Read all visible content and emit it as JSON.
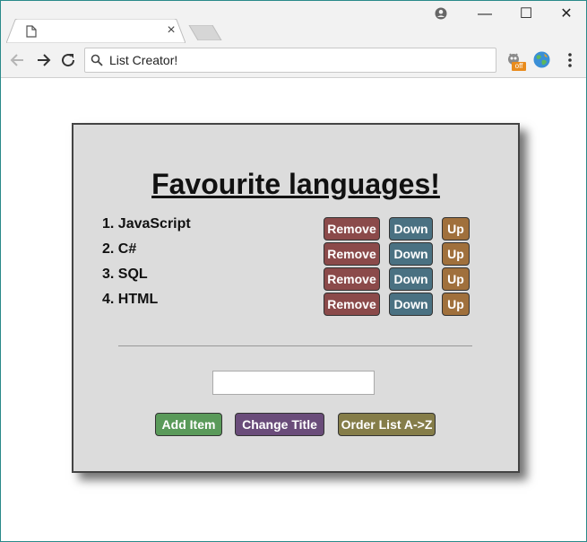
{
  "browser": {
    "tab_close": "×",
    "omnibox_text": "List Creator!",
    "ext_badge": "off",
    "window_controls": {
      "minimize": "—",
      "maximize": "☐",
      "close": "✕"
    }
  },
  "page": {
    "title": "Favourite languages!",
    "items": [
      {
        "text": "1. JavaScript"
      },
      {
        "text": "2. C#"
      },
      {
        "text": "3. SQL"
      },
      {
        "text": "4. HTML"
      }
    ],
    "remove_label": "Remove",
    "down_label": "Down",
    "up_label": "Up",
    "input_value": "",
    "add_label": "Add Item",
    "change_title_label": "Change Title",
    "order_label": "Order List A->Z"
  },
  "colors": {
    "remove": "#8b4a4a",
    "down": "#4a7182",
    "up": "#a0703c",
    "add": "#5a9a5a",
    "change_title": "#6a4c7a",
    "order": "#857d49"
  }
}
